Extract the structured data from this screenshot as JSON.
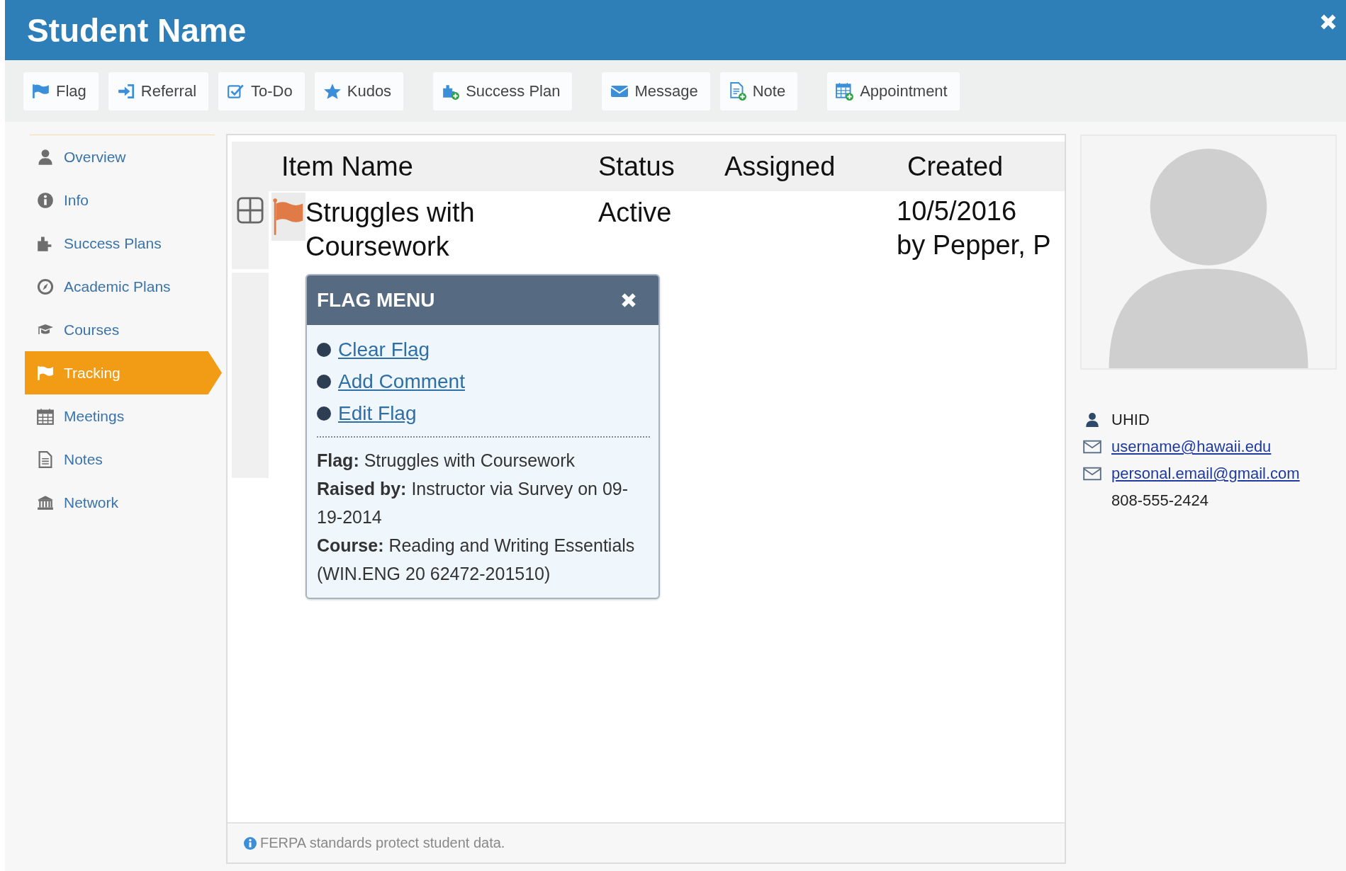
{
  "header": {
    "title": "Student Name"
  },
  "toolbar": [
    {
      "label": "Flag"
    },
    {
      "label": "Referral"
    },
    {
      "label": "To-Do"
    },
    {
      "label": "Kudos"
    },
    {
      "label": "Success Plan"
    },
    {
      "label": "Message"
    },
    {
      "label": "Note"
    },
    {
      "label": "Appointment"
    }
  ],
  "sidebar": {
    "items": [
      {
        "label": "Overview",
        "selected": false
      },
      {
        "label": "Info",
        "selected": false
      },
      {
        "label": "Success Plans",
        "selected": false
      },
      {
        "label": "Academic Plans",
        "selected": false
      },
      {
        "label": "Courses",
        "selected": false
      },
      {
        "label": "Tracking",
        "selected": true
      },
      {
        "label": "Meetings",
        "selected": false
      },
      {
        "label": "Notes",
        "selected": false
      },
      {
        "label": "Network",
        "selected": false
      }
    ]
  },
  "table": {
    "columns": [
      "Item Name",
      "Status",
      "Assigned",
      "Created"
    ],
    "rows": [
      {
        "item_name": "Struggles with Coursework",
        "status": "Active",
        "created": {
          "date": "10/5/2016",
          "by": "by Pepper, P"
        }
      }
    ]
  },
  "flag_menu": {
    "title": "FLAG MENU",
    "actions": [
      "Clear Flag",
      "Add Comment",
      "Edit Flag"
    ],
    "details": [
      "**Flag:** Struggles with Coursework",
      "**Raised by:** Instructor via Survey on 09-19-2014",
      "**Course:** Reading and Writing Essentials (WIN.ENG 20 62472-201510)"
    ]
  },
  "footer": {
    "note": "FERPA standards protect student data."
  },
  "contact": {
    "uhid": "UHID",
    "emails": [
      "username@hawaii.edu",
      "personal.email@gmail.com"
    ],
    "phone": "808-555-2424"
  }
}
